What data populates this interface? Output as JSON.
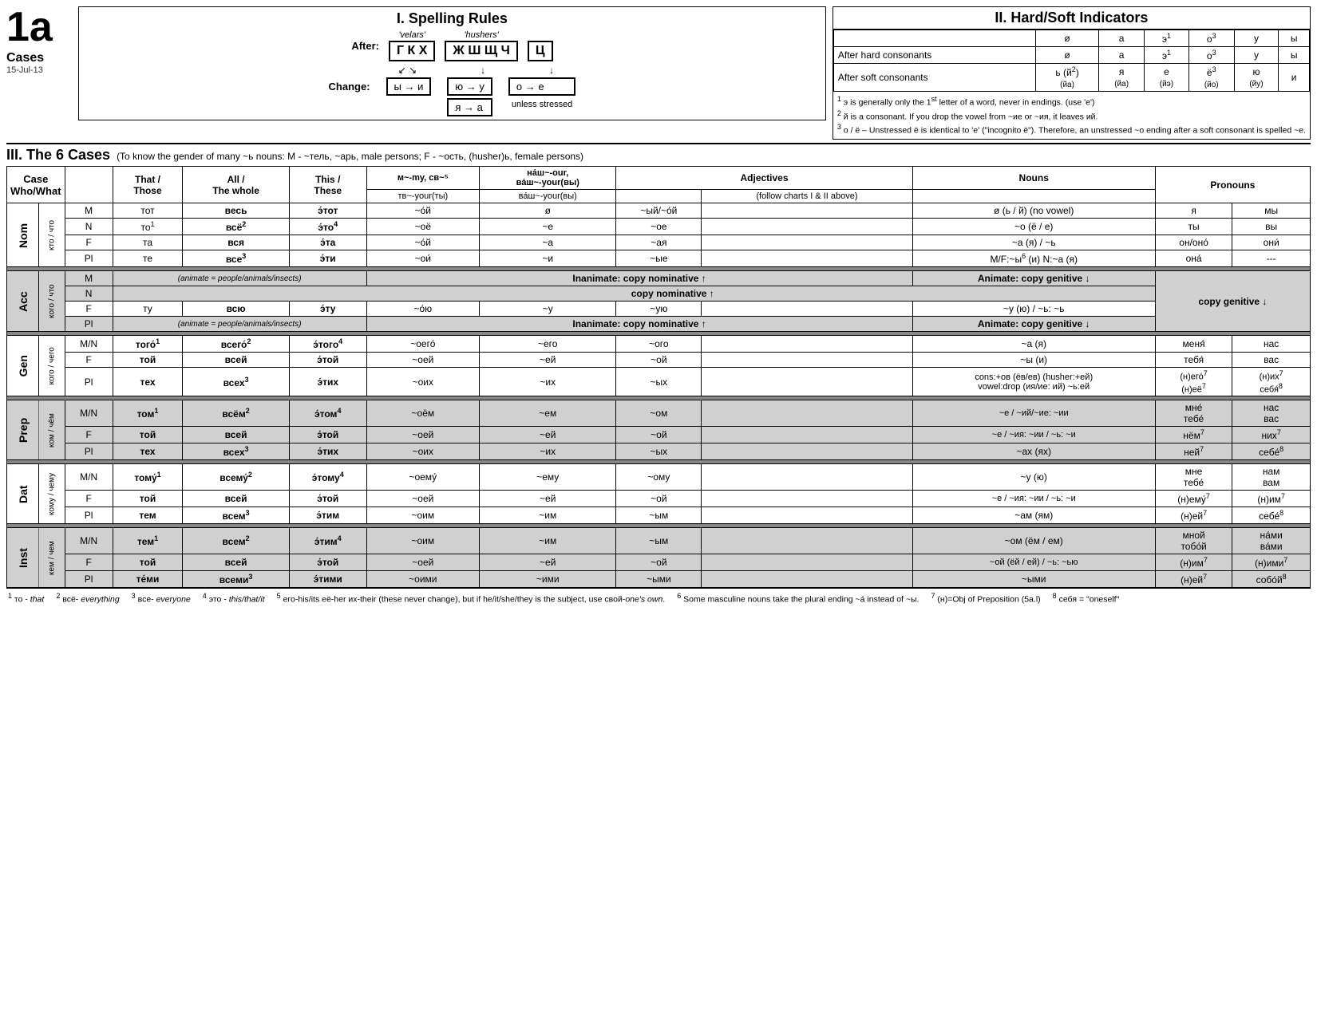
{
  "page": {
    "id_label": "1a",
    "cases_label": "Cases",
    "date_label": "15-Jul-13",
    "section1": {
      "title": "I. Spelling Rules",
      "after_label": "After:",
      "velars_label": "'velars'",
      "velars_letters": "Г К Х",
      "hushers_label": "'hushers'",
      "hushers_letters": "Ж Ш Щ Ч",
      "ts_letters": "Ц",
      "change_label": "Change:",
      "change1": "ы → и",
      "change2a": "ю → у",
      "change2b": "я → а",
      "change3": "о → е",
      "change3b": "unless stressed"
    },
    "section2": {
      "title": "II. Hard/Soft Indicators",
      "col_headers": [
        "ø",
        "а",
        "э¹",
        "о³",
        "у",
        "ы"
      ],
      "row1_label": "After hard consonants",
      "row1_vals": [
        "ø",
        "а",
        "э¹",
        "о³",
        "у",
        "ы"
      ],
      "row2_label": "After soft consonants",
      "row2_vals": [
        "ь (й²)",
        "я",
        "е",
        "ё³",
        "ю",
        "и"
      ],
      "row2_sub": [
        "(йа)",
        "(йэ)",
        "(йо)",
        "(йу)"
      ],
      "footnotes": [
        "¹ э is generally only the 1st letter of a word, never in endings. (use 'e')",
        "² й is a consonant.  If you drop the vowel from ~ие or ~ия, it leaves ий.",
        "³ о / ё – Unstressed ё is identical to 'e' (\"incognito ё\"). Therefore, an unstressed ~о ending after a soft consonant is spelled ~е."
      ]
    },
    "section3": {
      "title": "III. The 6 Cases",
      "subtitle": "(To know the gender of many ~ь nouns: M - ~тель, ~арь, male persons; F - ~ость, (husher)ь, female persons)",
      "col_headers": {
        "case": "Case",
        "who_what": "Who/What",
        "gender": "",
        "that_those": "That / Those",
        "all_whole": "All / The whole",
        "this_these": "This / These",
        "mv_sv": "м~-my, св~⁵",
        "nash_vash": "на́ш~-our, ва́ш~-your(вы)",
        "tv_vash2": "тв~-your(ты)",
        "adj": "Adjectives",
        "adj_follow": "(follow charts I & II above)",
        "nouns": "Nouns",
        "pronouns": "Pronouns"
      }
    },
    "table": {
      "nom": {
        "case_label": "Nom",
        "side_label": "кто / что",
        "rows": [
          {
            "gender": "М",
            "that": "тот",
            "all": "весь",
            "this": "э́тот",
            "mv_sv": "~о́й",
            "nash": "ø",
            "adj_hard": "~ый/~о́й",
            "nouns": "ø (ь / й) (no vowel)",
            "pron1": "я",
            "pron2": "мы"
          },
          {
            "gender": "N",
            "that": "то¹",
            "all": "всё²",
            "this": "э́то⁴",
            "mv_sv": "~оё",
            "nash": "~е",
            "adj_hard": "~ое",
            "nouns": "~о (ё / е)",
            "pron1": "ты",
            "pron2": "вы"
          },
          {
            "gender": "F",
            "that": "та",
            "all": "вся",
            "this": "э́та",
            "mv_sv": "~о́й",
            "nash": "~а",
            "adj_hard": "~ая",
            "nouns": "~а (я) / ~ь",
            "pron1": "он/оно́",
            "pron2": "они́"
          },
          {
            "gender": "Pl",
            "that": "те",
            "all": "все³",
            "this": "э́ти",
            "mv_sv": "~ои́",
            "nash": "~и",
            "adj_hard": "~ые",
            "nouns": "M/F:~ы⁶ (и)  N:~а (я)",
            "pron1": "она́",
            "pron2": "---"
          }
        ]
      },
      "acc": {
        "case_label": "Acc",
        "side_label": "кого / что",
        "rows": [
          {
            "gender": "М",
            "animate_note": "(animate = people/animals/insects)",
            "inanimate": "Inanimate: copy nominative ↑",
            "animate": "Animate: copy genitive ↓",
            "pron_note": ""
          },
          {
            "gender": "N",
            "center_note": "copy nominative ↑",
            "pron_note": ""
          },
          {
            "gender": "F",
            "that": "ту",
            "all": "всю",
            "this": "э́ту",
            "mv_sv": "~о́ю",
            "nash": "~у",
            "adj_hard": "~ую",
            "nouns": "~у (ю) / ~ь: ~ь",
            "pron_note": "copy genitive ↓"
          },
          {
            "gender": "Pl",
            "animate_note": "(animate = people/animals/insects)",
            "inanimate": "Inanimate: copy nominative ↑",
            "animate": "Animate: copy genitive ↓",
            "pron_note": ""
          }
        ]
      },
      "gen": {
        "case_label": "Gen",
        "side_label": "кого / чего",
        "rows": [
          {
            "gender": "M/N",
            "that": "того́¹",
            "all": "всего́²",
            "this": "э́того⁴",
            "mv_sv": "~оего́",
            "nash": "~его",
            "adj_hard": "~ого",
            "nouns": "~а (я)",
            "pron1": "меня́",
            "pron2": "нас"
          },
          {
            "gender": "F",
            "that": "той",
            "all": "всей",
            "this": "э́той",
            "mv_sv": "~оей",
            "nash": "~ей",
            "adj_hard": "~ой",
            "nouns": "~ы (и)",
            "pron1": "тебя́",
            "pron2": "вас"
          },
          {
            "gender": "Pl",
            "that": "тех",
            "all": "всех³",
            "this": "э́тих",
            "mv_sv": "~оих",
            "nash": "~их",
            "adj_hard": "~ых",
            "nouns": "cons:+ов (ёв/ев) (husher:+ей)\nvowel:drop (ия/ие: ий) ~ь:ей",
            "pron1": "(н)его́⁷",
            "pron2": "(н)их⁷",
            "pron3": "(н)её⁷",
            "pron4": "себя́⁸"
          }
        ]
      },
      "prep": {
        "case_label": "Prep",
        "side_label": "ком / чём",
        "rows": [
          {
            "gender": "M/N",
            "that": "том¹",
            "all": "всём²",
            "this": "э́том⁴",
            "mv_sv": "~оём",
            "nash": "~ем",
            "adj_hard": "~ом",
            "nouns": "~е / ~ий/~ие: ~ии",
            "pron1": "мне́",
            "pron2": "нас"
          },
          {
            "gender": "F",
            "that": "той",
            "all": "всей",
            "this": "э́той",
            "mv_sv": "~оей",
            "nash": "~ей",
            "adj_hard": "~ой",
            "nouns": "~е / ~ия: ~ии / ~ь: ~и",
            "pron1": "тебе́",
            "pron2": "вас"
          },
          {
            "gender": "Pl",
            "that": "тех",
            "all": "всех³",
            "this": "э́тих",
            "mv_sv": "~оих",
            "nash": "~их",
            "adj_hard": "~ых",
            "nouns": "~ах (ях)",
            "pron1": "нём⁷",
            "pron2": "них⁷",
            "pron3": "ней⁷",
            "pron4": "себе́⁸"
          }
        ]
      },
      "dat": {
        "case_label": "Dat",
        "side_label": "кому / чему",
        "rows": [
          {
            "gender": "M/N",
            "that": "тому́¹",
            "all": "всему́²",
            "this": "э́тому⁴",
            "mv_sv": "~оему́",
            "nash": "~ему",
            "adj_hard": "~ому",
            "nouns": "~у (ю)",
            "pron1": "мне",
            "pron2": "нам"
          },
          {
            "gender": "F",
            "that": "той",
            "all": "всей",
            "this": "э́той",
            "mv_sv": "~оей",
            "nash": "~ей",
            "adj_hard": "~ой",
            "nouns": "~е / ~ия: ~ии / ~ь: ~и",
            "pron1": "тебе́",
            "pron2": "вам"
          },
          {
            "gender": "Pl",
            "that": "тем",
            "all": "всем³",
            "this": "э́тим",
            "mv_sv": "~оим",
            "nash": "~им",
            "adj_hard": "~ым",
            "nouns": "~ам (ям)",
            "pron1": "(н)ему́⁷",
            "pron2": "(н)им⁷",
            "pron3": "(н)ей⁷",
            "pron4": "себе́⁸"
          }
        ]
      },
      "inst": {
        "case_label": "Inst",
        "side_label": "кем / чем",
        "rows": [
          {
            "gender": "M/N",
            "that": "тем¹",
            "all": "всем²",
            "this": "э́тим⁴",
            "mv_sv": "~оим",
            "nash": "~им",
            "adj_hard": "~ым",
            "nouns": "~ом (ём / ем)",
            "pron1": "мной",
            "pron2": "на́ми"
          },
          {
            "gender": "F",
            "that": "той",
            "all": "всей",
            "this": "э́той",
            "mv_sv": "~оей",
            "nash": "~ей",
            "adj_hard": "~ой",
            "nouns": "~ой (ёй / ей) / ~ь: ~ью",
            "pron1": "тобо́й",
            "pron2": "ва́ми"
          },
          {
            "gender": "Pl",
            "that": "те́ми",
            "all": "всеми³",
            "this": "э́тими",
            "mv_sv": "~оими",
            "nash": "~ими",
            "adj_hard": "~ыми",
            "nouns": "~ыми",
            "pron1": "(н)им⁷",
            "pron2": "(н)ими⁷",
            "pron3": "(н)ей⁷",
            "pron4": "собо́й⁸"
          }
        ]
      }
    },
    "footnotes_bottom": [
      "¹ то - that",
      "² всё- everything",
      "³ все- everyone",
      "⁴ это - this/that/it",
      "⁵ его-his/its её-her их-their (these never change), but if he/it/she/they is the subject, use свой-one's own.",
      "⁶ Some masculine nouns take the plural ending ~а́ instead of ~ы.",
      "⁷ (н)=Obj of Preposition (5a.l)",
      "⁸ себя = \"oneself\""
    ]
  }
}
